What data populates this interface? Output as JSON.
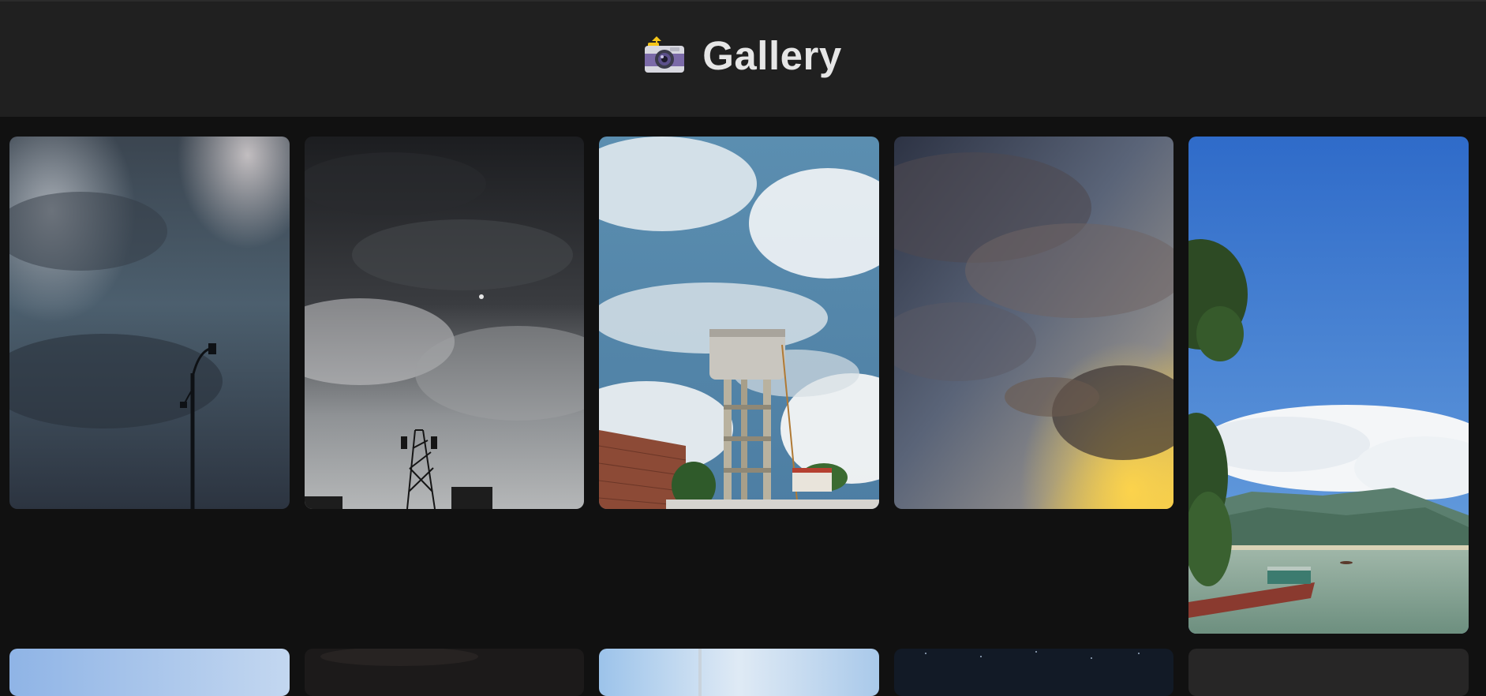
{
  "header": {
    "title": "Gallery",
    "icon": "camera-with-flash-icon"
  },
  "colors": {
    "background": "#111111",
    "header_background": "#202020",
    "title_text": "#e6e6e6"
  },
  "gallery": {
    "photos": [
      {
        "icon": "stormy-sky-streetlamp-photo"
      },
      {
        "icon": "night-clouds-tower-photo"
      },
      {
        "icon": "water-tower-blue-sky-photo"
      },
      {
        "icon": "dusk-clouds-sunset-photo"
      },
      {
        "icon": "river-boat-mountain-photo"
      },
      {
        "icon": "blue-sky-photo"
      },
      {
        "icon": "dark-photo"
      },
      {
        "icon": "light-sky-photo"
      },
      {
        "icon": "starry-night-photo"
      },
      {
        "icon": "dark-grey-photo"
      }
    ]
  }
}
